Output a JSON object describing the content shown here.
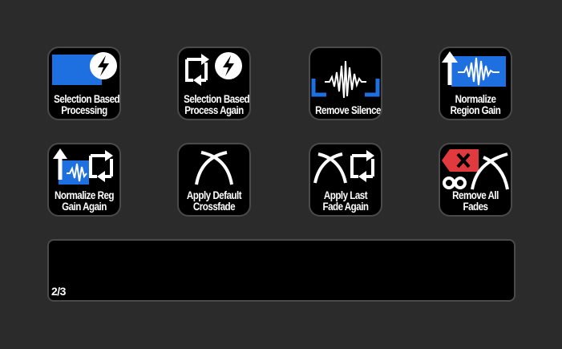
{
  "colors": {
    "background": "#2b2b2b",
    "key_bg": "#000000",
    "key_border": "#4a4a4a",
    "accent_blue": "#1e6fe0",
    "danger_red": "#e03a3e",
    "text": "#ffffff"
  },
  "keys": [
    {
      "line1": "Selection Based",
      "line2": "Processing",
      "icons": [
        "blue-toggle-icon",
        "lightning-bolt-icon"
      ]
    },
    {
      "line1": "Selection Based",
      "line2": "Process Again",
      "icons": [
        "repeat-icon",
        "lightning-bolt-icon"
      ]
    },
    {
      "line1": "Remove Silence",
      "line2": "",
      "icons": [
        "waveform-icon",
        "bracket-icon"
      ]
    },
    {
      "line1": "Normalize",
      "line2": "Region Gain",
      "icons": [
        "arrow-up-icon",
        "waveform-icon"
      ]
    },
    {
      "line1": "Normalize Reg",
      "line2": "Gain Again",
      "icons": [
        "arrow-up-icon",
        "waveform-icon",
        "repeat-icon"
      ]
    },
    {
      "line1": "Apply Default",
      "line2": "Crossfade",
      "icons": [
        "crossfade-icon"
      ]
    },
    {
      "line1": "Apply Last",
      "line2": "Fade Again",
      "icons": [
        "crossfade-icon",
        "repeat-icon"
      ]
    },
    {
      "line1": "Remove All",
      "line2": "Fades",
      "icons": [
        "delete-icon",
        "infinity-icon",
        "crossfade-icon"
      ]
    }
  ],
  "touchbar": {
    "page_indicator": "2/3"
  }
}
